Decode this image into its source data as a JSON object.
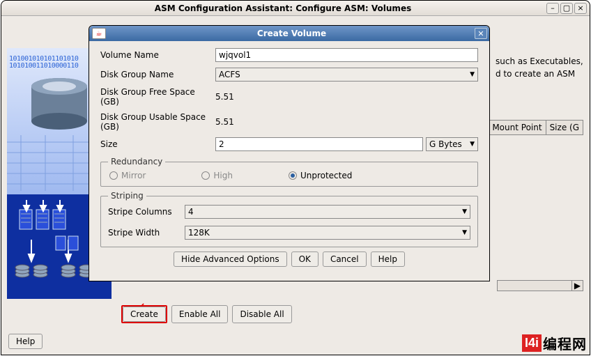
{
  "main_window": {
    "title": "ASM Configuration Assistant: Configure ASM: Volumes",
    "info_line1": "such as Executables,",
    "info_line2": "d to create an ASM",
    "table_headers": {
      "mount_point": "Mount Point",
      "size": "Size (G"
    },
    "bottom_buttons": {
      "create": "Create",
      "enable_all": "Enable All",
      "disable_all": "Disable All"
    },
    "help": "Help"
  },
  "dialog": {
    "title": "Create Volume",
    "labels": {
      "volume_name": "Volume Name",
      "disk_group_name": "Disk Group Name",
      "free_space": "Disk Group Free Space (GB)",
      "usable_space": "Disk Group Usable Space (GB)",
      "size": "Size",
      "redundancy": "Redundancy",
      "striping": "Striping",
      "stripe_columns": "Stripe Columns",
      "stripe_width": "Stripe Width"
    },
    "values": {
      "volume_name": "wjqvol1",
      "disk_group_name": "ACFS",
      "free_space": "5.51",
      "usable_space": "5.51",
      "size": "2",
      "size_unit": "G Bytes",
      "stripe_columns": "4",
      "stripe_width": "128K"
    },
    "redundancy": {
      "mirror": "Mirror",
      "high": "High",
      "unprotected": "Unprotected",
      "selected": "unprotected"
    },
    "buttons": {
      "hide_adv": "Hide Advanced Options",
      "ok": "OK",
      "cancel": "Cancel",
      "help": "Help"
    }
  },
  "watermark": {
    "logo": "I4i",
    "text": "编程网"
  }
}
